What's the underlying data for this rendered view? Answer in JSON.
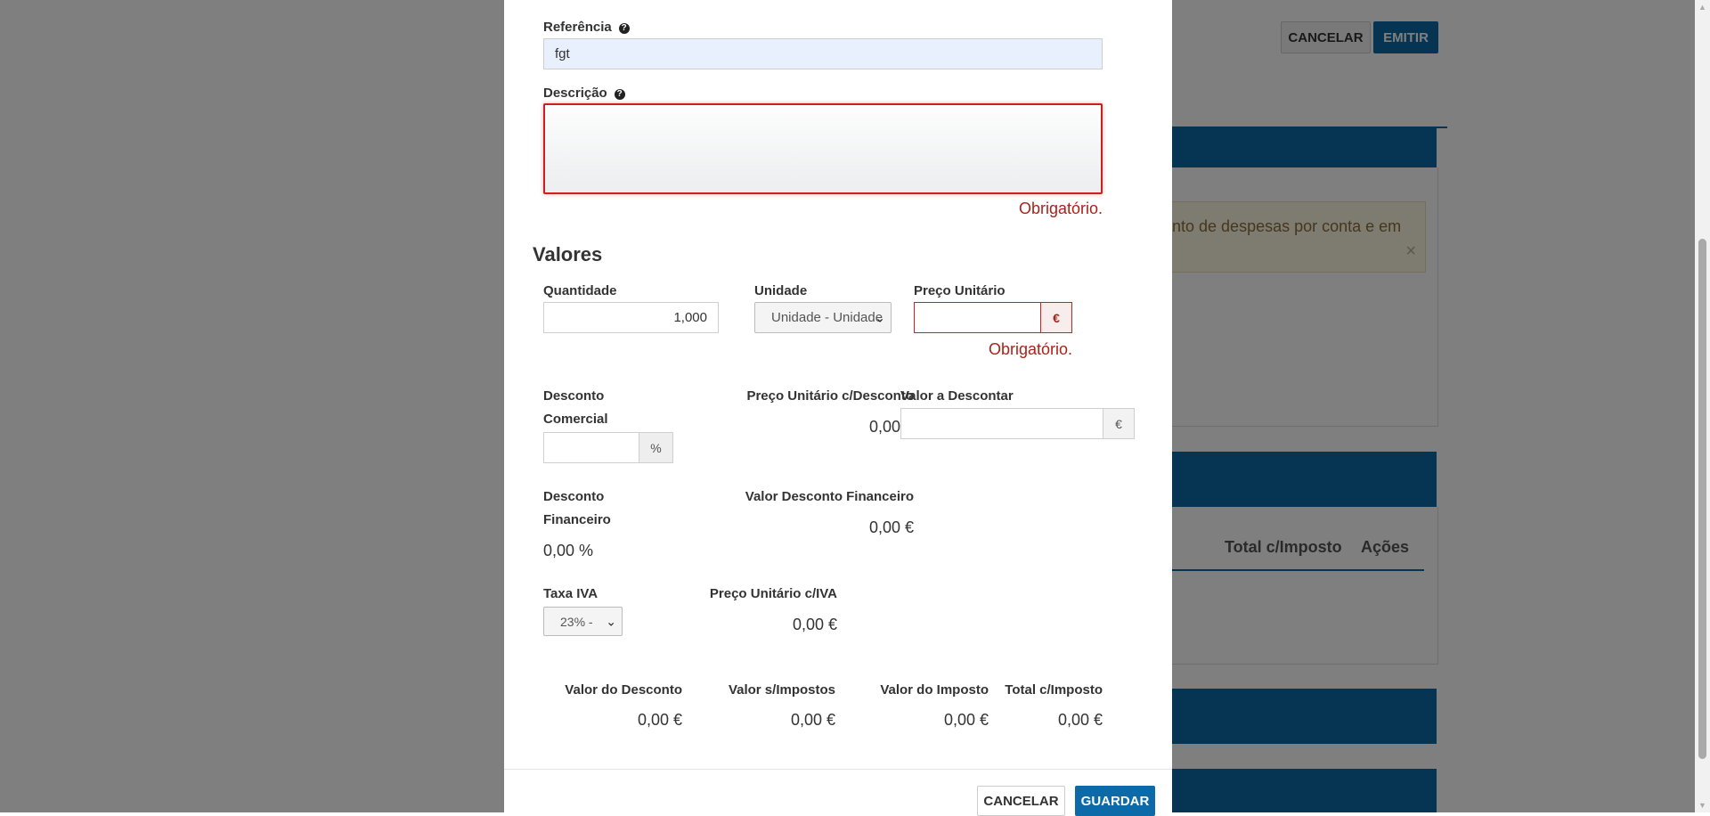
{
  "background": {
    "cancel_label": "CANCELAR",
    "emit_label": "EMITIR",
    "warning_text": "nto de despesas por conta e em",
    "warning_close": "×",
    "table_headers": [
      "Total c/Imposto",
      "Ações"
    ]
  },
  "modal": {
    "reference": {
      "label": "Referência",
      "value": "fgt"
    },
    "description": {
      "label": "Descrição",
      "value": "",
      "error": "Obrigatório."
    },
    "values_title": "Valores",
    "quantity": {
      "label": "Quantidade",
      "value": "1,000"
    },
    "unit": {
      "label": "Unidade",
      "selected": "Unidade - Unidade"
    },
    "unit_price": {
      "label": "Preço Unitário",
      "value": "",
      "currency": "€",
      "error": "Obrigatório."
    },
    "commercial_discount": {
      "label_line1": "Desconto",
      "label_line2": "Comercial",
      "value": "",
      "unit": "%"
    },
    "unit_price_discount": {
      "label": "Preço Unitário c/Desconto",
      "value": "0,00 €"
    },
    "discount_amount": {
      "label": "Valor a Descontar",
      "value": "",
      "currency": "€"
    },
    "financial_discount": {
      "label_line1": "Desconto",
      "label_line2": "Financeiro",
      "value": "0,00 %"
    },
    "financial_discount_value": {
      "label": "Valor Desconto Financeiro",
      "value": "0,00 €"
    },
    "vat_rate": {
      "label": "Taxa IVA",
      "selected": "23% -"
    },
    "unit_price_vat": {
      "label": "Preço Unitário c/IVA",
      "value": "0,00 €"
    },
    "totals": [
      {
        "label": "Valor do Desconto",
        "value": "0,00 €"
      },
      {
        "label": "Valor s/Impostos",
        "value": "0,00 €"
      },
      {
        "label": "Valor do Imposto",
        "value": "0,00 €"
      },
      {
        "label": "Total c/Imposto",
        "value": "0,00 €"
      }
    ],
    "footer": {
      "cancel_label": "CANCELAR",
      "save_label": "GUARDAR"
    }
  },
  "icons": {
    "help": "question-circle-icon",
    "chevron": "chevron-down-icon",
    "close": "close-icon"
  }
}
